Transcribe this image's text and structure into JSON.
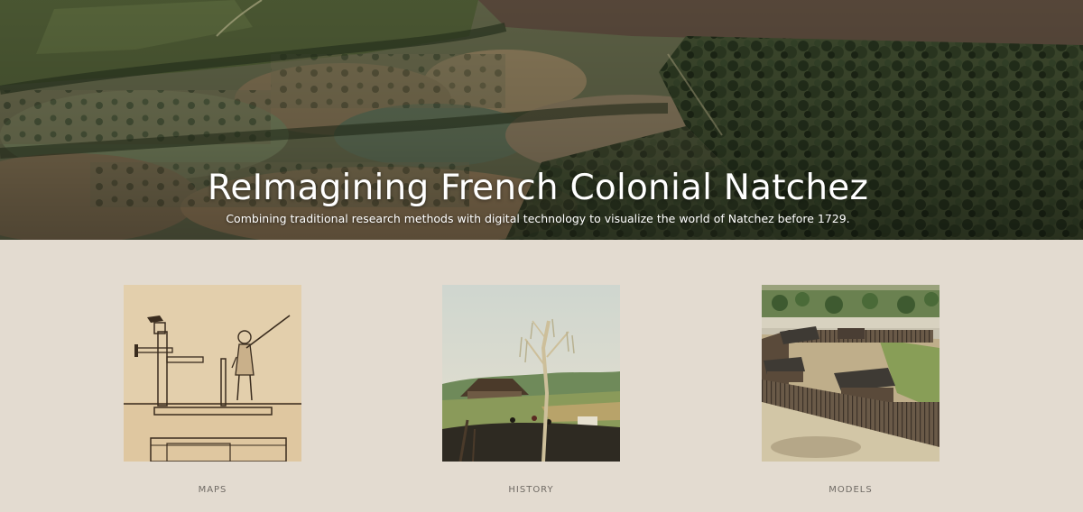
{
  "hero": {
    "title": "ReImagining French Colonial Natchez",
    "subtitle": "Combining traditional research methods with digital technology to visualize the world of Natchez before 1729."
  },
  "cards": [
    {
      "label": "MAPS",
      "image_icon": "sketch-drawing-of-soldier-with-cannon"
    },
    {
      "label": "HISTORY",
      "image_icon": "painting-of-landscape-with-tree"
    },
    {
      "label": "MODELS",
      "image_icon": "3d-model-of-fort-palisade"
    }
  ],
  "colors": {
    "page_background": "#e3dbd0",
    "label_text": "#6f6a64",
    "hero_text": "#ffffff"
  }
}
